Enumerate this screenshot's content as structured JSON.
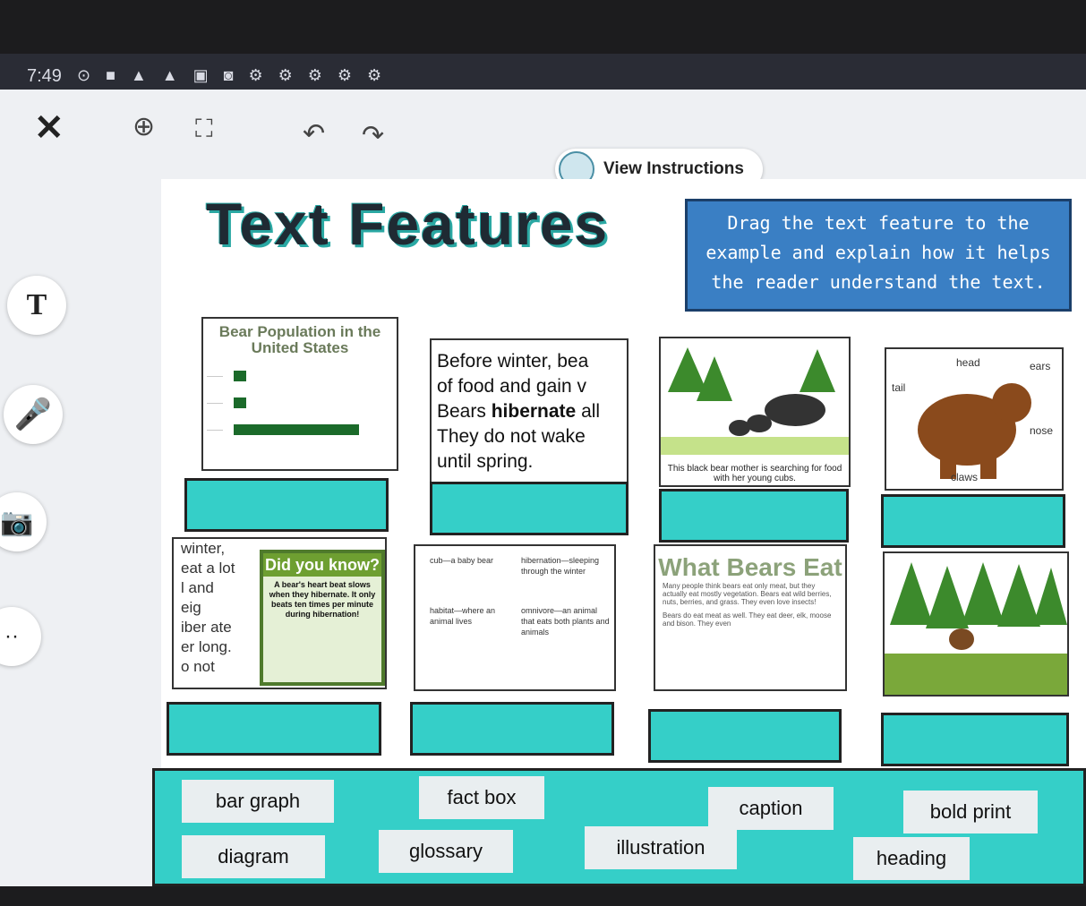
{
  "status_bar": {
    "time": "7:49",
    "icons": "⊙ ■ ▲ ▲ ▣ ◙ ⚙ ⚙ ⚙ ⚙ ⚙"
  },
  "toolbar": {
    "close": "✕",
    "zoom": "⊕",
    "fullscreen": "⛶",
    "undo": "↶",
    "redo": "↷",
    "view_instructions": "View Instructions"
  },
  "side_tools": {
    "text": "T",
    "mic": "🎤",
    "camera": "📷",
    "more": "··"
  },
  "worksheet": {
    "title": "Text Features",
    "instructions": "Drag the text feature to the example and explain how it helps the reader understand the text.",
    "bar_graph": {
      "title": "Bear Population in the United States",
      "values": [
        0.1,
        0.1,
        1.0
      ]
    },
    "paragraph": {
      "line1": "Before winter, bea",
      "line2": "of food and gain v",
      "line3a": "Bears ",
      "line3b": "hibernate",
      "line3c": " all",
      "line4": "They do not wake",
      "line5": "until spring."
    },
    "caption": "This black bear mother is searching for food with her young cubs.",
    "diagram": {
      "head": "head",
      "ears": "ears",
      "tail": "tail",
      "nose": "nose",
      "claws": "claws"
    },
    "fact": {
      "side1": "winter,",
      "side2": "eat a lot",
      "side3": "l and",
      "side4": "eig",
      "side5": "iber ate",
      "side6": "er long.",
      "side7": "o not",
      "title": "Did you know?",
      "body": "A bear's heart beat slows when they hibernate. It only beats ten times per minute during hibernation!"
    },
    "glossary": {
      "cub": "cub—a baby bear",
      "habitat": "habitat—where an animal lives",
      "hibernation": "hibernation—sleeping through the winter",
      "omnivore": "omnivore—an animal that eats both plants and animals"
    },
    "heading_example": {
      "heading": "What Bears Eat",
      "body": "Many people think bears eat only meat, but they actually eat mostly vegetation. Bears eat wild berries, nuts, berries, and grass. They even love insects!",
      "body2": "Bears do eat meat as well. They eat deer, elk, moose and bison. They even"
    }
  },
  "word_bank": [
    "bar graph",
    "fact box",
    "caption",
    "bold print",
    "diagram",
    "glossary",
    "illustration",
    "heading"
  ],
  "colors": {
    "teal": "#35cfc8",
    "instructions_blue": "#3a7fc4",
    "title_shadow": "#2aa8a3"
  }
}
